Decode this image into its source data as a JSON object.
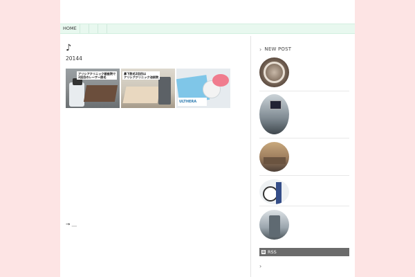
{
  "nav": {
    "home": "HOME"
  },
  "post": {
    "title": "♪",
    "meta": "20144",
    "thumbnails": [
      {
        "caption": "アリシアクリニック銀座院で\n2回目のレーザー脱毛"
      },
      {
        "caption": "鼻下脱毛2回目は\nアリシアクリニック池袋院"
      },
      {
        "caption": "ULTHERA"
      }
    ],
    "nav_text": "→ ＿"
  },
  "sidebar": {
    "new_post_heading": "NEW POST",
    "chevron": "›",
    "rss_label": "RSS",
    "rss_icon": "▦"
  }
}
